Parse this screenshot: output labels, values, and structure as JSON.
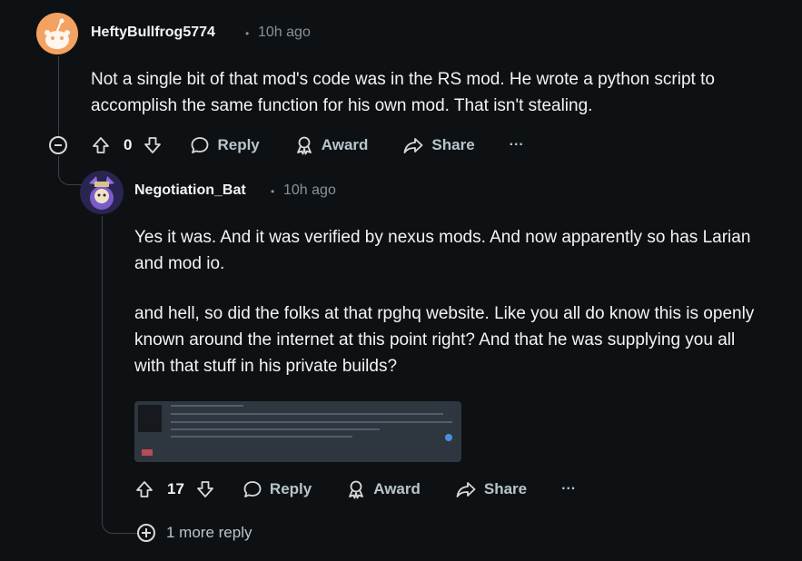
{
  "comment1": {
    "author": "HeftyBullfrog5774",
    "time": "10h ago",
    "body": "Not a single bit of that mod's code was in the RS mod. He wrote a python script to accomplish the same function for his own mod. That isn't stealing.",
    "score": "0",
    "reply_label": "Reply",
    "award_label": "Award",
    "share_label": "Share",
    "more_label": "···"
  },
  "comment2": {
    "author": "Negotiation_Bat",
    "time": "10h ago",
    "paragraphs": [
      "Yes it was. And it was verified by nexus mods. And now apparently so has Larian and mod io.",
      "and hell, so did the folks at that rpghq website. Like you all do know this is openly known around the internet at this point right? And that he was supplying you all with that stuff in his private builds?"
    ],
    "score": "17",
    "reply_label": "Reply",
    "award_label": "Award",
    "share_label": "Share",
    "more_label": "···"
  },
  "more_replies": "1 more reply",
  "separator": "•",
  "icons": {
    "upvote": "upvote-icon",
    "downvote": "downvote-icon",
    "reply": "speech-bubble-icon",
    "award": "award-icon",
    "share": "share-arrow-icon",
    "collapse": "minus-circle-icon",
    "expand": "plus-circle-icon"
  },
  "colors": {
    "background": "#0e1113",
    "text": "#f2f4f5",
    "muted": "#8a9196",
    "avatar1": "#f4a261"
  }
}
